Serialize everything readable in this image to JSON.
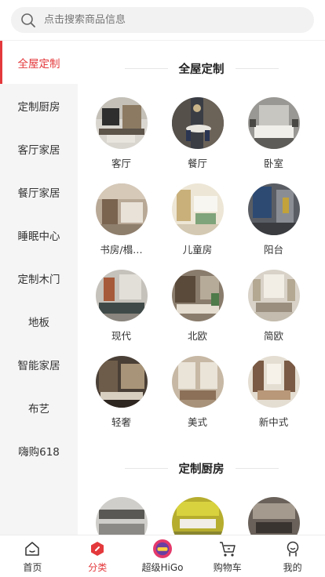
{
  "search": {
    "placeholder": "点击搜索商品信息"
  },
  "sidebar": {
    "items": [
      {
        "label": "全屋定制",
        "active": true
      },
      {
        "label": "定制厨房"
      },
      {
        "label": "客厅家居"
      },
      {
        "label": "餐厅家居"
      },
      {
        "label": "睡眠中心"
      },
      {
        "label": "定制木门"
      },
      {
        "label": "地板"
      },
      {
        "label": "智能家居"
      },
      {
        "label": "布艺"
      },
      {
        "label": "嗨购618"
      }
    ]
  },
  "sections": [
    {
      "title": "全屋定制",
      "items": [
        {
          "label": "客厅",
          "icon": "living-room-photo"
        },
        {
          "label": "餐厅",
          "icon": "dining-room-photo"
        },
        {
          "label": "卧室",
          "icon": "bedroom-photo"
        },
        {
          "label": "书房/榻…",
          "icon": "study-photo"
        },
        {
          "label": "儿童房",
          "icon": "kids-room-photo"
        },
        {
          "label": "阳台",
          "icon": "balcony-photo"
        },
        {
          "label": "现代",
          "icon": "modern-style-photo"
        },
        {
          "label": "北欧",
          "icon": "nordic-style-photo"
        },
        {
          "label": "简欧",
          "icon": "simple-european-photo"
        },
        {
          "label": "轻奢",
          "icon": "light-luxury-photo"
        },
        {
          "label": "美式",
          "icon": "american-style-photo"
        },
        {
          "label": "新中式",
          "icon": "new-chinese-style-photo"
        }
      ]
    },
    {
      "title": "定制厨房",
      "items": [
        {
          "label": "",
          "icon": "kitchen-photo-1"
        },
        {
          "label": "",
          "icon": "kitchen-photo-2"
        },
        {
          "label": "",
          "icon": "kitchen-photo-3"
        }
      ]
    }
  ],
  "tabbar": {
    "items": [
      {
        "label": "首页",
        "icon": "home-icon"
      },
      {
        "label": "分类",
        "icon": "category-icon",
        "active": true
      },
      {
        "label": "超级HiGo",
        "icon": "higo-logo-icon"
      },
      {
        "label": "购物车",
        "icon": "cart-icon"
      },
      {
        "label": "我的",
        "icon": "profile-icon"
      }
    ]
  },
  "colors": {
    "accent": "#e4393c",
    "sidebar_bg": "#f5f5f5"
  }
}
